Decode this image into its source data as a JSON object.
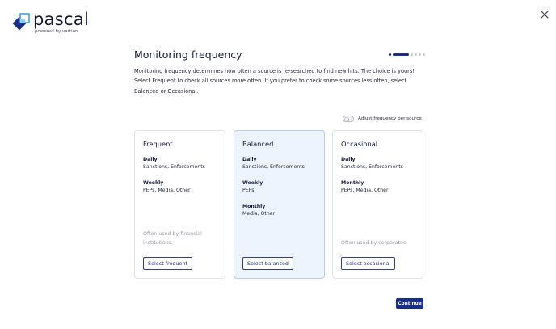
{
  "brand": {
    "name": "pascal",
    "tagline": "powered by vartion",
    "colors": {
      "dark_blue": "#1a2f88",
      "light_blue": "#3ea3e5",
      "light_cyan": "#8fd0f5"
    }
  },
  "header": {
    "close_icon": "close-icon",
    "title": "Monitoring frequency",
    "progress": {
      "total_steps": 6,
      "current_step": 2
    }
  },
  "description": "Monitoring frequency determines how often a source is re-searched to find new hits. The choice is yours! Select Frequent to check all sources more often. If you prefer to check some sources less often, select Balanced or Occasional.",
  "toggle": {
    "label": "Adjust frequency per source",
    "on": false
  },
  "cards": [
    {
      "title": "Frequent",
      "groups": [
        {
          "label": "Daily",
          "items": "Sanctions, Enforcements"
        },
        {
          "label": "Weekly",
          "items": "PEPs, Media, Other"
        }
      ],
      "note": "Often used by financial institutions.",
      "button": "Select frequent",
      "selected": false
    },
    {
      "title": "Balanced",
      "groups": [
        {
          "label": "Daily",
          "items": "Sanctions, Enforcements"
        },
        {
          "label": "Weekly",
          "items": "PEPs"
        },
        {
          "label": "Monthly",
          "items": "Media, Other"
        }
      ],
      "note": "",
      "button": "Select balanced",
      "selected": true
    },
    {
      "title": "Occasional",
      "groups": [
        {
          "label": "Daily",
          "items": "Sanctions, Enforcements"
        },
        {
          "label": "Monthly",
          "items": "PEPs, Media, Other"
        }
      ],
      "note": "Often used by corporates.",
      "button": "Select occasional",
      "selected": false
    }
  ],
  "continue_label": "Continue"
}
